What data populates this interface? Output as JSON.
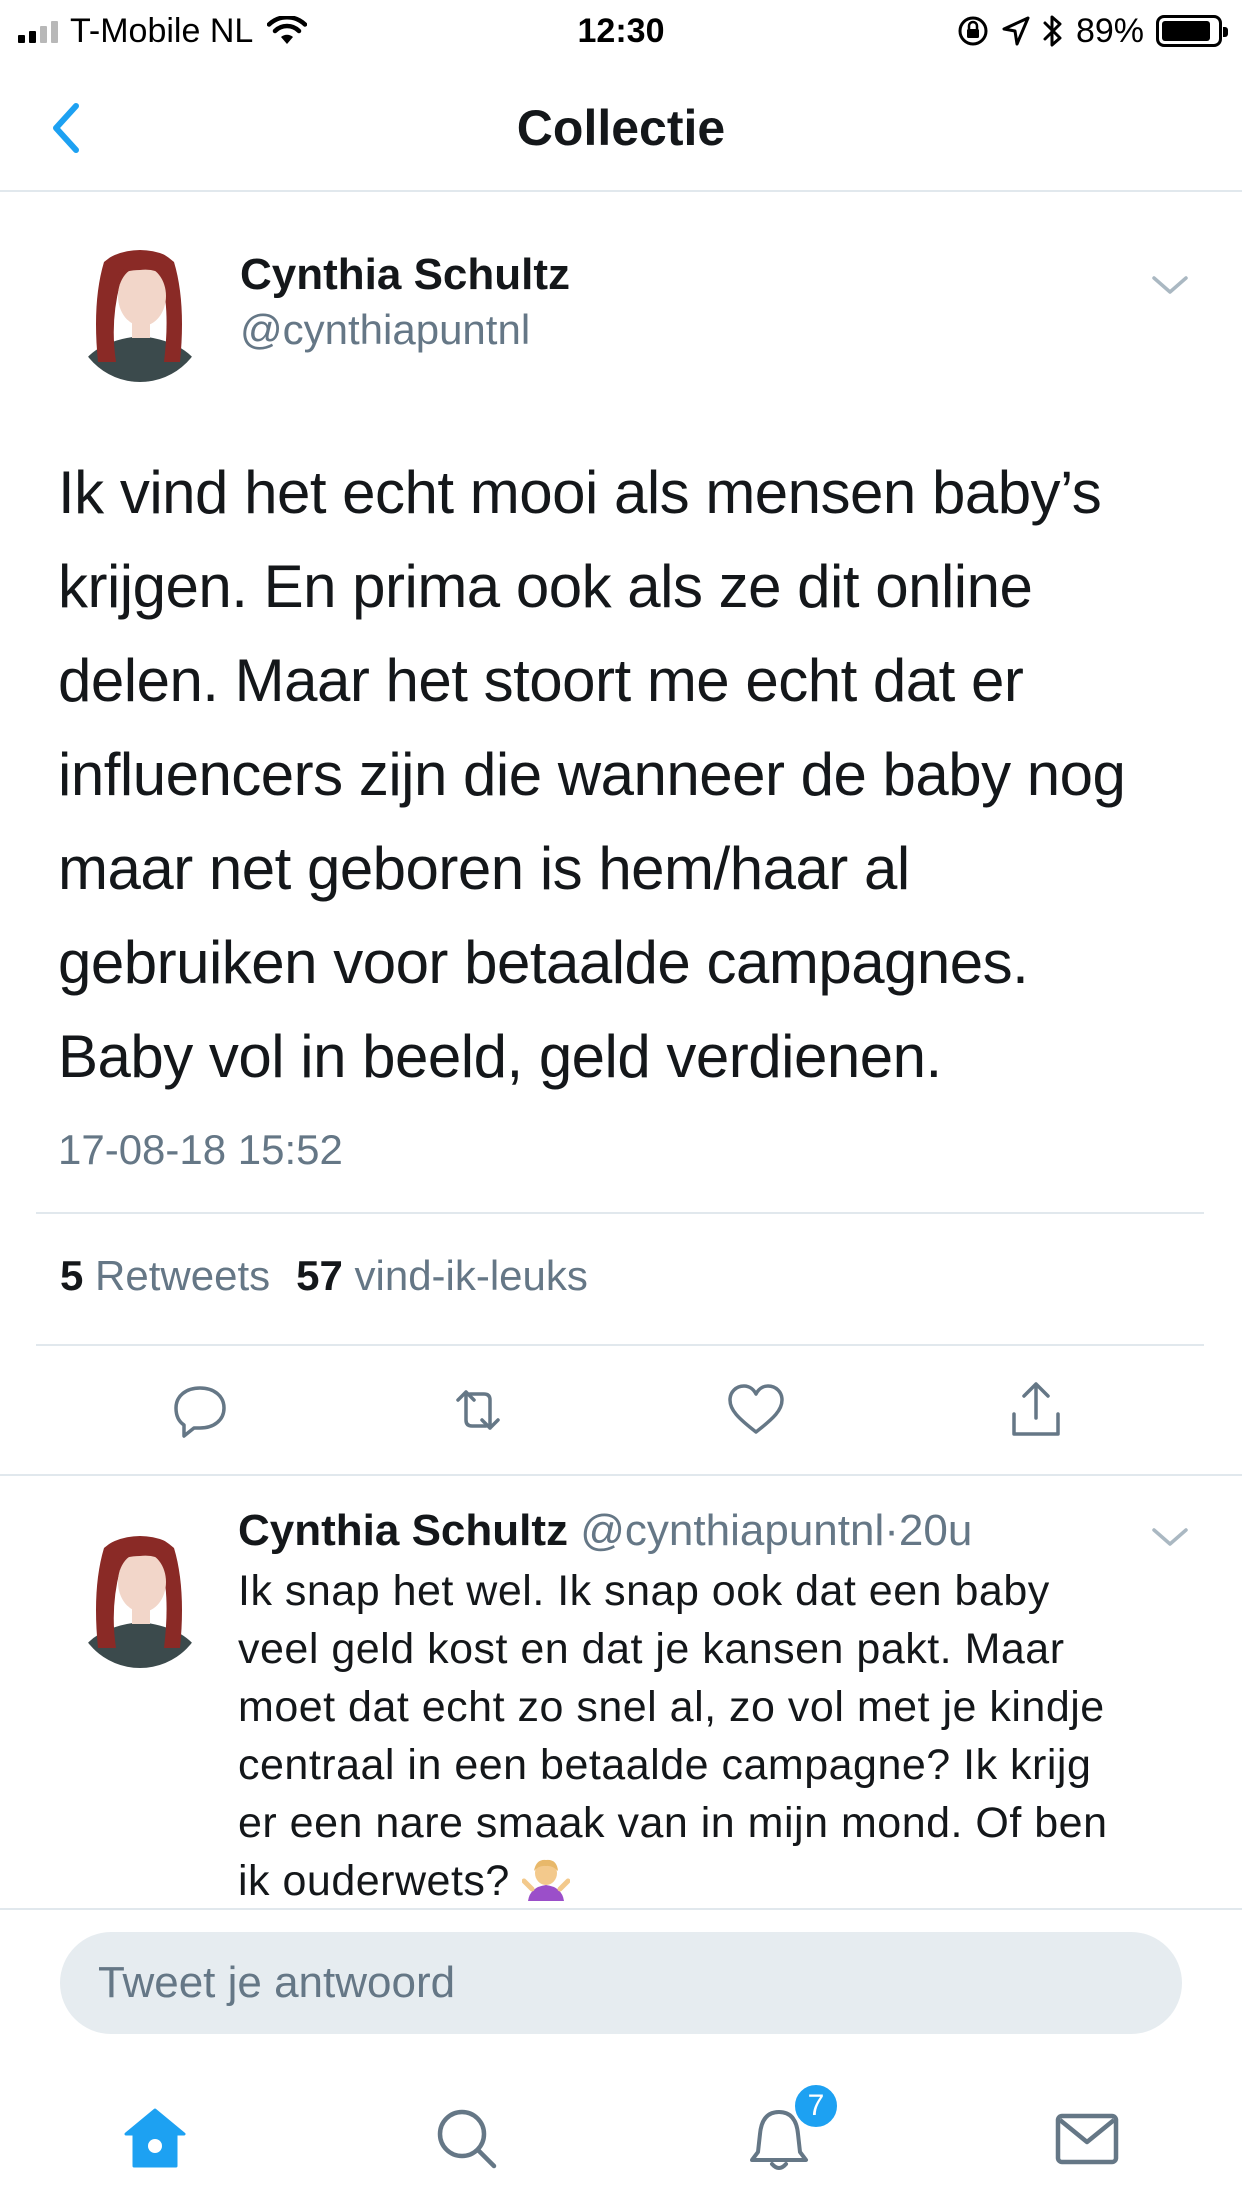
{
  "status_bar": {
    "carrier": "T-Mobile NL",
    "time": "12:30",
    "battery_percent": "89%",
    "battery_level": 0.89,
    "signal_bars": 2,
    "icons": [
      "wifi-icon",
      "orientation-lock-icon",
      "location-icon",
      "bluetooth-icon",
      "battery-icon"
    ]
  },
  "nav": {
    "title": "Collectie",
    "back_icon": "chevron-left-icon"
  },
  "tweet": {
    "author_name": "Cynthia Schultz",
    "author_handle": "@cynthiapuntnl",
    "lines": [
      "Ik vind het echt mooi als mensen baby’s",
      "krijgen. En prima ook als ze dit online",
      "delen. Maar het stoort me echt dat er",
      "influencers zijn die wanneer de baby nog",
      "maar net geboren is hem/haar al",
      "gebruiken voor betaalde campagnes.",
      "Baby vol in beeld, geld verdienen."
    ],
    "date": "17-08-18 15:52",
    "retweets_count": "5",
    "retweets_label": "Retweets",
    "likes_count": "57",
    "likes_label": "vind-ik-leuks",
    "actions": [
      "reply-icon",
      "retweet-icon",
      "like-icon",
      "share-icon"
    ]
  },
  "reply": {
    "author_name": "Cynthia Schultz",
    "author_handle": "@cynthiapuntnl",
    "separator": "·",
    "age": "20u",
    "lines": [
      "Ik snap het wel. Ik snap ook dat een baby",
      "veel geld kost en dat je kansen pakt. Maar",
      "moet dat echt zo snel al, zo vol met je kindje",
      "centraal in een betaalde campagne? Ik krijg",
      "er een nare smaak van in mijn mond. Of ben",
      "ik ouderwets?"
    ],
    "emoji": "shrugging-woman-emoji"
  },
  "compose": {
    "placeholder": "Tweet je antwoord"
  },
  "tab_bar": {
    "items": [
      "home-icon",
      "search-icon",
      "notifications-icon",
      "messages-icon"
    ],
    "active": "home-icon",
    "notifications_badge": "7"
  },
  "colors": {
    "accent": "#1da1f2",
    "text_primary": "#14171a",
    "text_secondary": "#657786",
    "divider": "#e1e8ed",
    "input_bg": "#e6ecf0"
  }
}
